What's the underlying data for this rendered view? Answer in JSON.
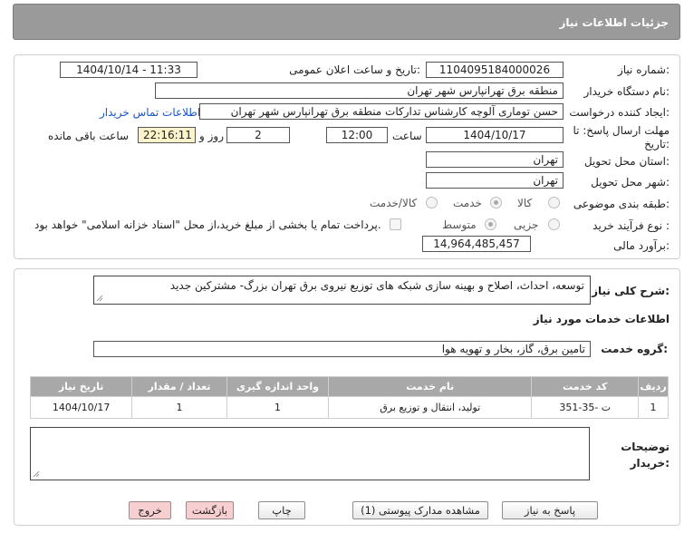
{
  "header": {
    "title": "جزئیات اطلاعات نیاز"
  },
  "form": {
    "need_number_label": "شماره نیاز:",
    "need_number": "1104095184000026",
    "announce_label": "تاریخ و ساعت اعلان عمومی:",
    "announce_value": "1404/10/14 - 11:33",
    "buyer_org_label": "نام دستگاه خریدار:",
    "buyer_org": "منطقه برق تهرانپارس شهر تهران",
    "creator_label": "ایجاد کننده درخواست:",
    "creator": "حسن توماری آلوچه کارشناس تدارکات منطقه برق تهرانپارس شهر تهران",
    "contact_link": "اطلاعات تماس خریدار",
    "deadline_label": "مهلت ارسال پاسخ: تا تاریخ:",
    "deadline_date": "1404/10/17",
    "time_label": "ساعت",
    "deadline_time": "12:00",
    "days_value": "2",
    "days_label": "روز و",
    "remaining_time": "22:16:11",
    "remaining_label": "ساعت باقی مانده",
    "province_label": "استان محل تحویل:",
    "province": "تهران",
    "city_label": "شهر محل تحویل:",
    "city": "تهران",
    "category_label": "طبقه بندی موضوعی:",
    "category_options": [
      "کالا",
      "خدمت",
      "کالا/خدمت"
    ],
    "category_selected": "خدمت",
    "process_label": "نوع فرآیند خرید :",
    "process_options": [
      "جزیی",
      "متوسط"
    ],
    "process_selected": "متوسط",
    "payment_note": "پرداخت تمام یا بخشی از مبلغ خرید،از محل \"اسناد خزانه اسلامی\" خواهد بود.",
    "budget_label": "برآورد مالی:",
    "budget": "14,964,485,457"
  },
  "description": {
    "label": "شرح کلی نیاز:",
    "text": "توسعه، احداث، اصلاح و بهینه سازی شبکه های توزیع نیروی برق تهران بزرگ- مشترکین جدید"
  },
  "services": {
    "section_title": "اطلاعات خدمات مورد نیاز",
    "group_label": "گروه خدمت:",
    "group_value": "تامین برق، گاز، بخار و تهویه هوا",
    "table": {
      "headers": [
        "ردیف",
        "کد خدمت",
        "نام خدمت",
        "واحد اندازه گیری",
        "تعداد / مقدار",
        "تاریخ نیاز"
      ],
      "rows": [
        [
          "1",
          "ت -35-351",
          "تولید، انتقال و توزیع برق",
          "1",
          "1",
          "1404/10/17"
        ]
      ]
    },
    "buyer_notes_label": "توضیحات خریدار:",
    "buyer_notes": ""
  },
  "buttons": {
    "reply": "پاسخ به نیاز",
    "attachments": "مشاهده مدارک پیوستی (1)",
    "print": "چاپ",
    "back": "بازگشت",
    "exit": "خروج"
  },
  "colors": {
    "header_bg": "#9a9a9a",
    "table_header_bg": "#a8a8a8",
    "remaining_bg": "#fbf3c9",
    "link": "#1a55c8",
    "pink_button": "#f7cfd0"
  }
}
